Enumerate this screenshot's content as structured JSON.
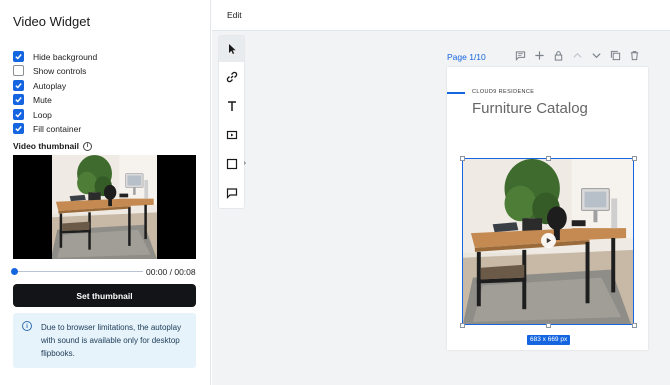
{
  "sidebar": {
    "title": "Video Widget",
    "options": [
      {
        "label": "Hide background",
        "checked": true
      },
      {
        "label": "Show controls",
        "checked": false
      },
      {
        "label": "Autoplay",
        "checked": true
      },
      {
        "label": "Mute",
        "checked": true
      },
      {
        "label": "Loop",
        "checked": true
      },
      {
        "label": "Fill container",
        "checked": true
      }
    ],
    "thumbnail_label": "Video thumbnail",
    "info_glyph": "i",
    "time": "00:00 / 00:08",
    "playback_progress": 0,
    "set_thumbnail_label": "Set thumbnail",
    "notice": "Due to browser limitations, the autoplay with sound is available only for desktop flipbooks."
  },
  "toolbar": {
    "edit_label": "Edit"
  },
  "tools": [
    {
      "icon": "cursor-icon",
      "selected": true
    },
    {
      "icon": "link-icon",
      "selected": false
    },
    {
      "icon": "text-icon",
      "selected": false
    },
    {
      "icon": "video-icon",
      "selected": false
    },
    {
      "icon": "shape-icon",
      "selected": false
    },
    {
      "icon": "comment-icon",
      "selected": false
    }
  ],
  "page": {
    "label": "Page 1/10",
    "brand": "CLOUD9 RESIDENCE",
    "title": "Furniture Catalog",
    "dimensions": "683 x 669 px",
    "actions": [
      "comment-icon",
      "plus-icon",
      "lock-icon",
      "chevron-up-icon",
      "chevron-down-icon",
      "duplicate-icon",
      "trash-icon"
    ]
  },
  "colors": {
    "accent": "#1565e0",
    "button_dark": "#121417",
    "notice_bg": "#e6f3fb",
    "canvas_bg": "#f1f3f5"
  }
}
